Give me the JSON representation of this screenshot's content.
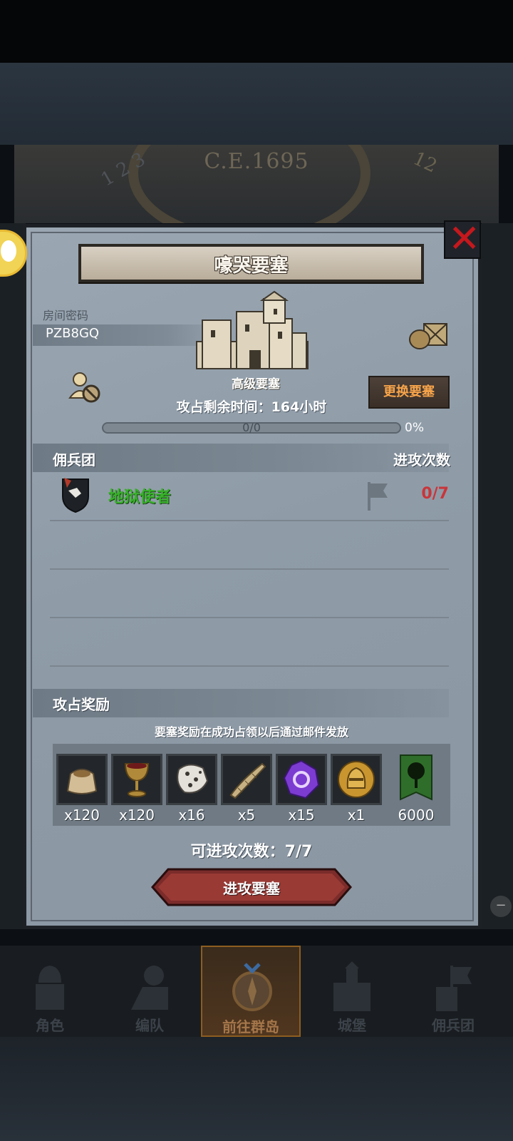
{
  "background": {
    "era_text": "C.E.1695",
    "dial_numbers": [
      "1 2 3",
      "12"
    ]
  },
  "dialog": {
    "title": "嚎哭要塞",
    "room": {
      "label": "房间密码",
      "code": "PZB8GQ"
    },
    "fortress_type": "高级要塞",
    "change_button": "更换要塞",
    "time_remaining": "攻占剩余时间：164小时",
    "progress": {
      "label": "0/0",
      "percent_text": "0%",
      "fraction": 0
    },
    "mercenary_header": {
      "left": "佣兵团",
      "right": "进攻次数"
    },
    "mercenaries": [
      {
        "name": "地狱使者",
        "attacks": "0/7"
      }
    ],
    "rewards_header": "攻占奖励",
    "reward_note": "要塞奖励在成功占领以后通过邮件发放",
    "rewards": [
      {
        "icon": "sack-icon",
        "qty": "x120"
      },
      {
        "icon": "goblet-icon",
        "qty": "x120"
      },
      {
        "icon": "ore-icon",
        "qty": "x16"
      },
      {
        "icon": "horn-icon",
        "qty": "x5"
      },
      {
        "icon": "purple-gem-icon",
        "qty": "x15"
      },
      {
        "icon": "gold-helmet-icon",
        "qty": "x1"
      },
      {
        "icon": "tree-banner-icon",
        "qty": "6000"
      }
    ],
    "attack_count": "可进攻次数：7/7",
    "attack_button": "进攻要塞"
  },
  "nav": [
    {
      "label": "角色",
      "icon": "knight-icon"
    },
    {
      "label": "编队",
      "icon": "formation-icon"
    },
    {
      "label": "前往群岛",
      "icon": "compass-icon",
      "active": true
    },
    {
      "label": "城堡",
      "icon": "castle-icon"
    },
    {
      "label": "佣兵团",
      "icon": "mercenary-icon"
    }
  ],
  "colors": {
    "panel": "#929eaa",
    "accent_gold": "#c9a04a",
    "mercenary_name": "#37b22a",
    "attack_count": "#c9353a",
    "close": "#c4181d",
    "change_button_text": "#f7a44a"
  }
}
